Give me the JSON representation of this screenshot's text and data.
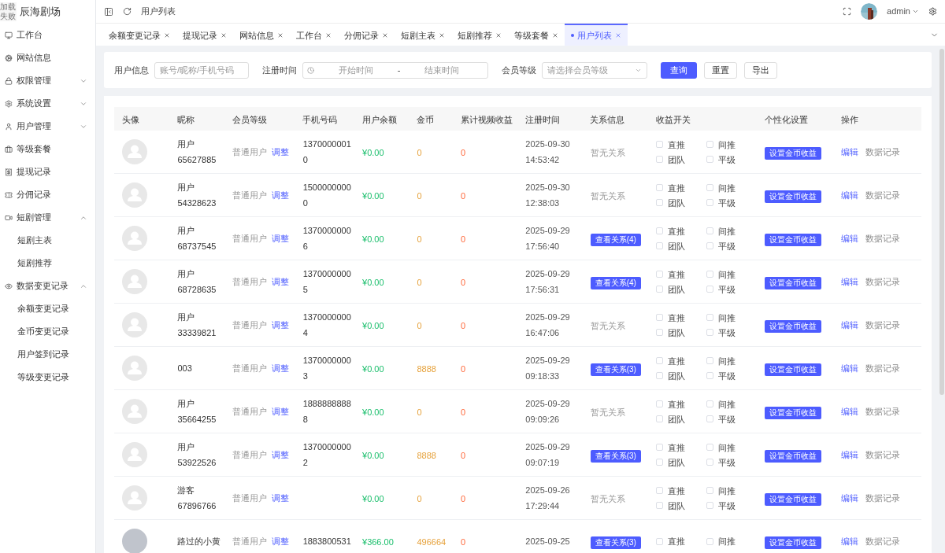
{
  "logo": {
    "alt_text": "加载失败",
    "title": "辰海剧场"
  },
  "sidebar": {
    "items": [
      {
        "label": "工作台"
      },
      {
        "label": "网站信息"
      },
      {
        "label": "权限管理",
        "expanded": false
      },
      {
        "label": "系统设置",
        "expanded": false
      },
      {
        "label": "用户管理",
        "expanded": false
      },
      {
        "label": "等级套餐"
      },
      {
        "label": "提现记录"
      },
      {
        "label": "分佣记录"
      },
      {
        "label": "短剧管理",
        "expanded": true,
        "children": [
          {
            "label": "短剧主表"
          },
          {
            "label": "短剧推荐"
          }
        ]
      },
      {
        "label": "数据变更记录",
        "expanded": true,
        "children": [
          {
            "label": "余额变更记录"
          },
          {
            "label": "金币变更记录"
          },
          {
            "label": "用户签到记录"
          },
          {
            "label": "等级变更记录"
          }
        ]
      }
    ]
  },
  "header": {
    "breadcrumb": "用户列表",
    "user": "admin"
  },
  "tabs": [
    {
      "label": "余额变更记录",
      "selected": false
    },
    {
      "label": "提现记录",
      "selected": false
    },
    {
      "label": "网站信息",
      "selected": false
    },
    {
      "label": "工作台",
      "selected": false
    },
    {
      "label": "分佣记录",
      "selected": false
    },
    {
      "label": "短剧主表",
      "selected": false
    },
    {
      "label": "短剧推荐",
      "selected": false
    },
    {
      "label": "等级套餐",
      "selected": false
    },
    {
      "label": "用户列表",
      "selected": true
    }
  ],
  "filters": {
    "user_label": "用户信息",
    "user_placeholder": "账号/昵称/手机号码",
    "date_label": "注册时间",
    "start_placeholder": "开始时间",
    "separator": "-",
    "end_placeholder": "结束时间",
    "level_label": "会员等级",
    "level_placeholder": "请选择会员等级",
    "buttons": [
      {
        "label": "查询",
        "kind": "primary"
      },
      {
        "label": "重置",
        "kind": "default"
      },
      {
        "label": "导出",
        "kind": "default"
      }
    ]
  },
  "table": {
    "columns": [
      "头像",
      "昵称",
      "会员等级",
      "手机号码",
      "用户余额",
      "金币",
      "累计视频收益",
      "注册时间",
      "关系信息",
      "收益开关",
      "个性化设置",
      "操作"
    ],
    "rows": [
      {
        "avatar": {
          "kind": "placeholder"
        },
        "nickname": "用户65627885",
        "level": "普通用户",
        "adjust": "调整",
        "phone": "13700000010",
        "balance": "¥0.00",
        "coins": "0",
        "video_income": "0",
        "registered": "2025-09-30 14:53:42",
        "relation": {
          "kind": "text",
          "label": "暂无关系"
        },
        "switches": [
          {
            "label": "直推",
            "checked": false
          },
          {
            "label": "间推",
            "checked": false
          },
          {
            "label": "团队",
            "checked": false
          },
          {
            "label": "平级",
            "checked": false
          }
        ],
        "setting": "设置金币收益",
        "actions": [
          "编辑",
          "数据记录"
        ]
      },
      {
        "avatar": {
          "kind": "placeholder"
        },
        "nickname": "用户54328623",
        "level": "普通用户",
        "adjust": "调整",
        "phone": "15000000000",
        "balance": "¥0.00",
        "coins": "0",
        "video_income": "0",
        "registered": "2025-09-30 12:38:03",
        "relation": {
          "kind": "text",
          "label": "暂无关系"
        },
        "switches": [
          {
            "label": "直推",
            "checked": false
          },
          {
            "label": "间推",
            "checked": false
          },
          {
            "label": "团队",
            "checked": false
          },
          {
            "label": "平级",
            "checked": false
          }
        ],
        "setting": "设置金币收益",
        "actions": [
          "编辑",
          "数据记录"
        ]
      },
      {
        "avatar": {
          "kind": "placeholder"
        },
        "nickname": "用户68737545",
        "level": "普通用户",
        "adjust": "调整",
        "phone": "13700000006",
        "balance": "¥0.00",
        "coins": "0",
        "video_income": "0",
        "registered": "2025-09-29 17:56:40",
        "relation": {
          "kind": "button",
          "label": "查看关系(4)"
        },
        "switches": [
          {
            "label": "直推",
            "checked": false
          },
          {
            "label": "间推",
            "checked": false
          },
          {
            "label": "团队",
            "checked": false
          },
          {
            "label": "平级",
            "checked": false
          }
        ],
        "setting": "设置金币收益",
        "actions": [
          "编辑",
          "数据记录"
        ]
      },
      {
        "avatar": {
          "kind": "placeholder"
        },
        "nickname": "用户68728635",
        "level": "普通用户",
        "adjust": "调整",
        "phone": "13700000005",
        "balance": "¥0.00",
        "coins": "0",
        "video_income": "0",
        "registered": "2025-09-29 17:56:31",
        "relation": {
          "kind": "button",
          "label": "查看关系(4)"
        },
        "switches": [
          {
            "label": "直推",
            "checked": false
          },
          {
            "label": "间推",
            "checked": false
          },
          {
            "label": "团队",
            "checked": false
          },
          {
            "label": "平级",
            "checked": false
          }
        ],
        "setting": "设置金币收益",
        "actions": [
          "编辑",
          "数据记录"
        ]
      },
      {
        "avatar": {
          "kind": "placeholder"
        },
        "nickname": "用户33339821",
        "level": "普通用户",
        "adjust": "调整",
        "phone": "13700000004",
        "balance": "¥0.00",
        "coins": "0",
        "video_income": "0",
        "registered": "2025-09-29 16:47:06",
        "relation": {
          "kind": "text",
          "label": "暂无关系"
        },
        "switches": [
          {
            "label": "直推",
            "checked": false
          },
          {
            "label": "间推",
            "checked": false
          },
          {
            "label": "团队",
            "checked": false
          },
          {
            "label": "平级",
            "checked": false
          }
        ],
        "setting": "设置金币收益",
        "actions": [
          "编辑",
          "数据记录"
        ]
      },
      {
        "avatar": {
          "kind": "placeholder"
        },
        "nickname": "003",
        "level": "普通用户",
        "adjust": "调整",
        "phone": "13700000003",
        "balance": "¥0.00",
        "coins": "8888",
        "video_income": "0",
        "registered": "2025-09-29 09:18:33",
        "relation": {
          "kind": "button",
          "label": "查看关系(3)"
        },
        "switches": [
          {
            "label": "直推",
            "checked": false
          },
          {
            "label": "间推",
            "checked": false
          },
          {
            "label": "团队",
            "checked": false
          },
          {
            "label": "平级",
            "checked": false
          }
        ],
        "setting": "设置金币收益",
        "actions": [
          "编辑",
          "数据记录"
        ]
      },
      {
        "avatar": {
          "kind": "placeholder"
        },
        "nickname": "用户35664255",
        "level": "普通用户",
        "adjust": "调整",
        "phone": "18888888888",
        "balance": "¥0.00",
        "coins": "0",
        "video_income": "0",
        "registered": "2025-09-29 09:09:26",
        "relation": {
          "kind": "text",
          "label": "暂无关系"
        },
        "switches": [
          {
            "label": "直推",
            "checked": false
          },
          {
            "label": "间推",
            "checked": false
          },
          {
            "label": "团队",
            "checked": false
          },
          {
            "label": "平级",
            "checked": false
          }
        ],
        "setting": "设置金币收益",
        "actions": [
          "编辑",
          "数据记录"
        ]
      },
      {
        "avatar": {
          "kind": "placeholder"
        },
        "nickname": "用户53922526",
        "level": "普通用户",
        "adjust": "调整",
        "phone": "13700000002",
        "balance": "¥0.00",
        "coins": "8888",
        "video_income": "0",
        "registered": "2025-09-29 09:07:19",
        "relation": {
          "kind": "button",
          "label": "查看关系(3)"
        },
        "switches": [
          {
            "label": "直推",
            "checked": false
          },
          {
            "label": "间推",
            "checked": false
          },
          {
            "label": "团队",
            "checked": false
          },
          {
            "label": "平级",
            "checked": false
          }
        ],
        "setting": "设置金币收益",
        "actions": [
          "编辑",
          "数据记录"
        ]
      },
      {
        "avatar": {
          "kind": "placeholder"
        },
        "nickname": "游客67896766",
        "level": "普通用户",
        "adjust": "调整",
        "balance": "¥0.00",
        "coins": "0",
        "video_income": "0",
        "registered": "2025-09-26 17:29:44",
        "relation": {
          "kind": "text",
          "label": "暂无关系"
        },
        "switches": [
          {
            "label": "直推",
            "checked": false
          },
          {
            "label": "间推",
            "checked": false
          },
          {
            "label": "团队",
            "checked": false
          },
          {
            "label": "平级",
            "checked": false
          }
        ],
        "setting": "设置金币收益",
        "actions": [
          "编辑",
          "数据记录"
        ]
      },
      {
        "avatar": {
          "kind": "blank"
        },
        "nickname": "路过的小黄",
        "level": "普通用户",
        "adjust": "调整",
        "phone": "1883800531",
        "balance": "¥366.00",
        "coins": "496664",
        "video_income": "0",
        "registered": "2025-09-25",
        "relation": {
          "kind": "button",
          "label": "查看关系(3)"
        },
        "switches": [
          {
            "label": "直推",
            "checked": false
          },
          {
            "label": "间推",
            "checked": false
          }
        ],
        "setting": "设置金币收益",
        "actions": [
          "编辑",
          "数据记录"
        ]
      }
    ]
  }
}
